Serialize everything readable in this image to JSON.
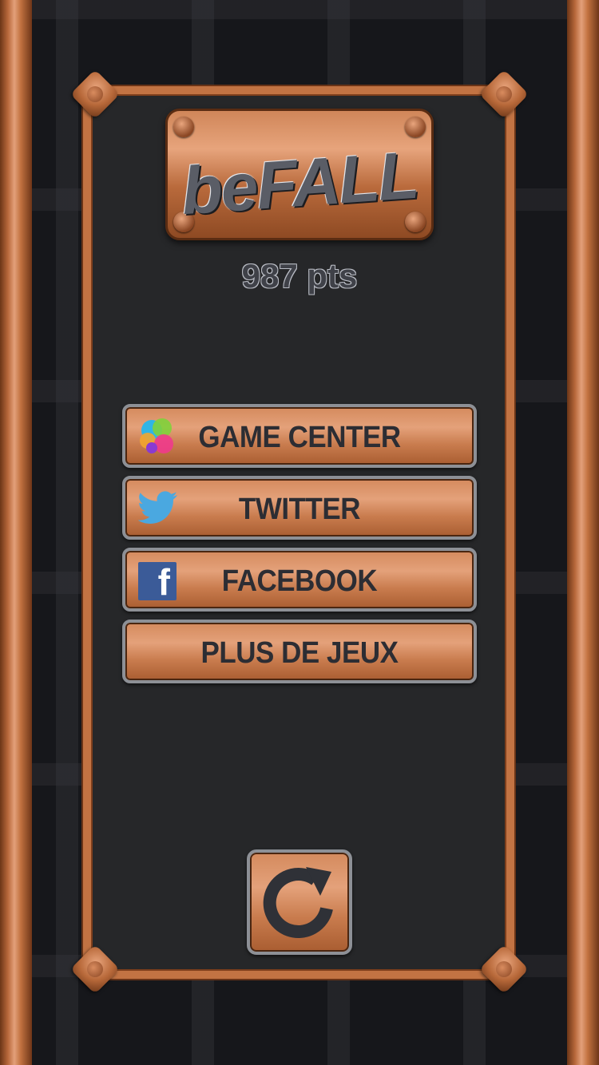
{
  "logo": {
    "text": "beFALL"
  },
  "score": {
    "text": "987 pts"
  },
  "menu": {
    "game_center": {
      "label": "GAME CENTER",
      "icon": "game-center-icon"
    },
    "twitter": {
      "label": "TWITTER",
      "icon": "twitter-bird-icon"
    },
    "facebook": {
      "label": "FACEBOOK",
      "icon": "facebook-f-icon"
    },
    "more_games": {
      "label": "PLUS DE JEUX"
    }
  },
  "replay": {
    "icon": "replay-arrow-icon"
  },
  "colors": {
    "copper": "#c27343",
    "panel": "#262729",
    "button_text": "#2c2d33",
    "facebook_blue": "#3b5b98",
    "twitter_blue": "#4aa8e0"
  }
}
